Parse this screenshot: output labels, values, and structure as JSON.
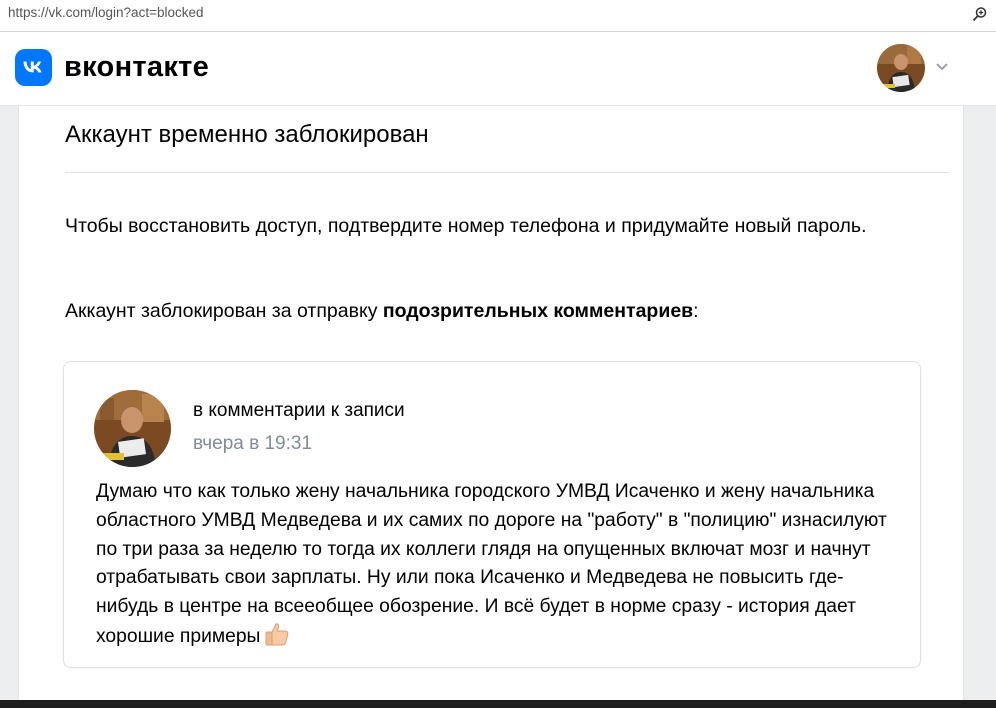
{
  "browser": {
    "url": "https://vk.com/login?act=blocked"
  },
  "header": {
    "brand": "вконтакте",
    "logo_icon": "vk-logo-icon",
    "accent": "#0077ff"
  },
  "main": {
    "title": "Аккаунт временно заблокирован",
    "paragraph": "Чтобы восстановить доступ, подтвердите номер телефона и придумайте новый пароль.",
    "reason_prefix": "Аккаунт заблокирован за отправку ",
    "reason_bold": "подозрительных комментариев",
    "reason_suffix": ":"
  },
  "comment": {
    "context": "в комментарии к записи",
    "time": "вчера в 19:31",
    "time_color": "#818c99",
    "text": "Думаю что как только жену начальника городского УМВД Исаченко и жену начальника областного УМВД Медведева и их самих по дороге на \"работу\" в \"полицию\" изнасилуют по три раза за неделю то тогда их коллеги глядя на опущенных включат мозг и начнут отрабатывать свои зарплаты. Ну или пока Исаченко и Медведева не повысить где-нибудь в центре на всееобщее обозрение. И всё будет в норме сразу - история дает хорошие примеры",
    "emoji_icon": "thumbs-up-icon"
  }
}
